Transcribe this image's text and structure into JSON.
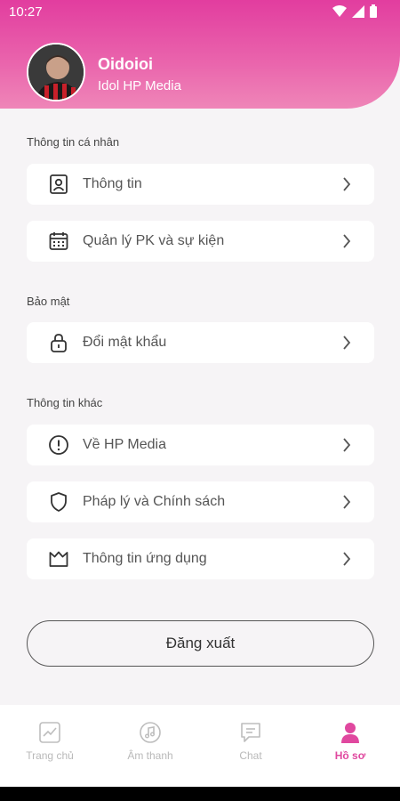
{
  "status_bar": {
    "time": "10:27"
  },
  "profile": {
    "name": "Oidoioi",
    "role": "Idol HP Media"
  },
  "sections": {
    "personal": {
      "title": "Thông tin cá nhân",
      "items": [
        {
          "label": "Thông tin",
          "icon": "user-card-icon"
        },
        {
          "label": "Quản lý PK và sự kiện",
          "icon": "calendar-icon"
        }
      ]
    },
    "security": {
      "title": "Bảo mật",
      "items": [
        {
          "label": "Đổi mật khẩu",
          "icon": "lock-icon"
        }
      ]
    },
    "other": {
      "title": "Thông tin khác",
      "items": [
        {
          "label": "Về HP Media",
          "icon": "info-icon"
        },
        {
          "label": "Pháp lý và Chính sách",
          "icon": "shield-icon"
        },
        {
          "label": "Thông tin ứng dụng",
          "icon": "crown-icon"
        }
      ]
    }
  },
  "logout_label": "Đăng xuất",
  "bottom_nav": [
    {
      "label": "Trang chủ",
      "icon": "chart-icon"
    },
    {
      "label": "Âm thanh",
      "icon": "music-icon"
    },
    {
      "label": "Chat",
      "icon": "chat-icon"
    },
    {
      "label": "Hồ sơ",
      "icon": "profile-icon",
      "active": true
    }
  ],
  "colors": {
    "accent": "#e0489f",
    "header_top": "#e23d9f",
    "header_bottom": "#ef86b8"
  }
}
